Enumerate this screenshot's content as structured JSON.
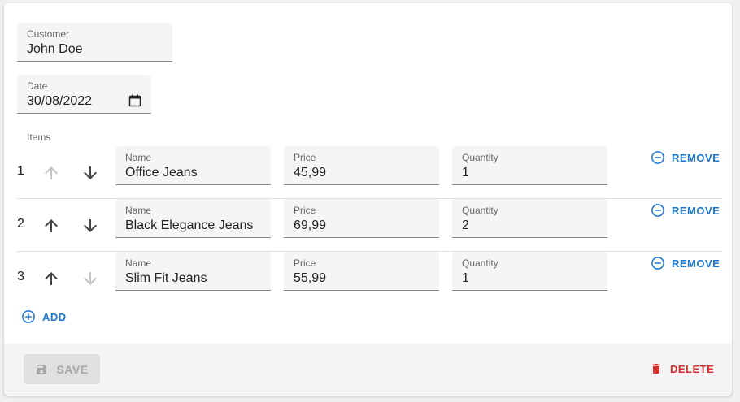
{
  "customer": {
    "label": "Customer",
    "value": "John Doe"
  },
  "date": {
    "label": "Date",
    "value": "30/08/2022"
  },
  "items_label": "Items",
  "columns": {
    "name": "Name",
    "price": "Price",
    "quantity": "Quantity"
  },
  "items": [
    {
      "index": "1",
      "name": "Office Jeans",
      "price": "45,99",
      "quantity": "1",
      "can_move_up": false,
      "can_move_down": true
    },
    {
      "index": "2",
      "name": "Black Elegance Jeans",
      "price": "69,99",
      "quantity": "2",
      "can_move_up": true,
      "can_move_down": true
    },
    {
      "index": "3",
      "name": "Slim Fit Jeans",
      "price": "55,99",
      "quantity": "1",
      "can_move_up": true,
      "can_move_down": false
    }
  ],
  "remove_label": "REMOVE",
  "add_label": "ADD",
  "toolbar": {
    "save_label": "SAVE",
    "save_disabled": true,
    "delete_label": "DELETE"
  },
  "colors": {
    "primary": "#1976d2",
    "danger": "#d32f2f",
    "disabled": "#a6a6a6"
  },
  "icons": {
    "move_up": "arrow-up-icon",
    "move_down": "arrow-down-icon",
    "remove": "remove-circle-icon",
    "add": "add-circle-icon",
    "save": "floppy-icon",
    "delete": "trash-icon",
    "calendar": "calendar-icon"
  }
}
